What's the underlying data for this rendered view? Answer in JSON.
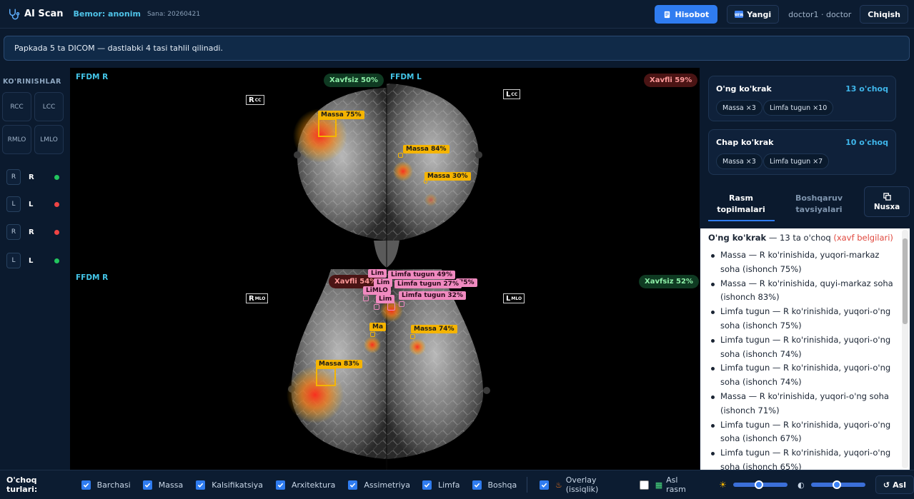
{
  "header": {
    "app_title": "AI Scan",
    "patient": "Bemor: anonim",
    "date": "Sana: 20260421",
    "report_button": "Hisobot",
    "new_button": "Yangi",
    "user": "doctor1 · doctor",
    "exit_button": "Chiqish"
  },
  "banner": {
    "text": "Papkada 5 ta DICOM — dastlabki 4 tasi tahlil qilinadi."
  },
  "sidebar": {
    "title": "KO'RINISHLAR",
    "views": [
      "RCC",
      "LCC",
      "RMLO",
      "LMLO"
    ],
    "sides": [
      {
        "box": "R",
        "label": "R",
        "status_color": "#22c55e"
      },
      {
        "box": "L",
        "label": "L",
        "status_color": "#ef4444"
      },
      {
        "box": "R",
        "label": "R",
        "status_color": "#ef4444"
      },
      {
        "box": "L",
        "label": "L",
        "status_color": "#22c55e"
      }
    ]
  },
  "viewer": {
    "top_left_label": "FFDM R",
    "top_right_label": "FFDM L",
    "bottom_left_label": "FFDM R",
    "risk_top_left": "Xavfsiz 50%",
    "risk_top_right": "Xavfli 59%",
    "risk_bottom_left": "Xavfli 54%",
    "risk_bottom_right": "Xavfsiz 52%",
    "orient_rcc": "R",
    "orient_lcc": "L",
    "orient_rmlo": "R",
    "orient_lmlo": "L",
    "orient_cc_suffix": "CC",
    "orient_mlo_suffix": "MLO",
    "tags_top": [
      "Massa 75%",
      "Massa 84%",
      "Massa 30%"
    ],
    "tags_bottom_yellow": [
      "Massa 74%",
      "Massa 83%",
      "Ma"
    ],
    "tags_bottom_pink": [
      "Limfa tugun 49%",
      "Limfa tugun 27%",
      "Limfa tugun 32%",
      "Limfa tugun 75%",
      "Lim",
      "Lim",
      "Lim",
      "Lim",
      "75%",
      "LiMLO"
    ]
  },
  "right_panel": {
    "cards": [
      {
        "title": "O'ng ko'krak",
        "count": "13 o'choq",
        "chips": [
          "Massa ×3",
          "Limfa tugun ×10"
        ]
      },
      {
        "title": "Chap ko'krak",
        "count": "10 o'choq",
        "chips": [
          "Massa ×3",
          "Limfa tugun ×7"
        ]
      }
    ],
    "tabs": [
      "Rasm topilmalari",
      "Boshqaruv tavsiyalari"
    ],
    "copy_button": "Nusxa",
    "findings_title": "O'ng ko'krak",
    "findings_count": " — 13 ta o'choq ",
    "findings_warning": "(xavf belgilari)",
    "findings": [
      "Massa — R ko'rinishida, yuqori-markaz soha (ishonch 75%)",
      "Massa — R ko'rinishida, quyi-markaz soha (ishonch 83%)",
      "Limfa tugun — R ko'rinishida, yuqori-o'ng soha (ishonch 75%)",
      "Limfa tugun — R ko'rinishida, yuqori-o'ng soha (ishonch 74%)",
      "Limfa tugun — R ko'rinishida, yuqori-o'ng soha (ishonch 74%)",
      "Massa — R ko'rinishida, yuqori-o'ng soha (ishonch 71%)",
      "Limfa tugun — R ko'rinishida, yuqori-o'ng soha (ishonch 67%)",
      "Limfa tugun — R ko'rinishida, yuqori-o'ng soha (ishonch 65%)"
    ]
  },
  "bottom_bar": {
    "label": "O'choq turlari:",
    "filters": [
      "Barchasi",
      "Massa",
      "Kalsifikatsiya",
      "Arxitektura",
      "Assimetriya",
      "Limfa",
      "Boshqa"
    ],
    "overlay": "Overlay (issiqlik)",
    "original": "Asl rasm",
    "reset_button": "Asl",
    "brightness_value": 0.5,
    "contrast_value": 0.5
  },
  "colors": {
    "accent": "#2f7cf0",
    "cyan": "#43c5e8",
    "mass_tag": "#f5b400",
    "lymph_tag": "#f08ac0"
  }
}
